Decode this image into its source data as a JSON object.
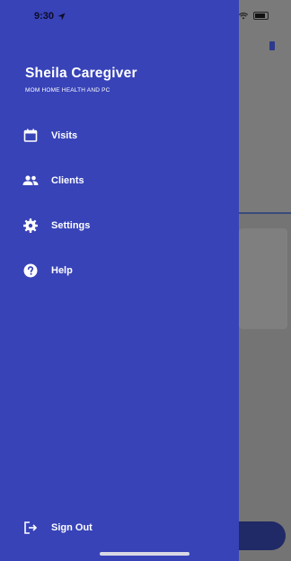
{
  "status_bar": {
    "time": "9:30"
  },
  "drawer": {
    "user_name": "Sheila Caregiver",
    "organization": "MOM HOME HEALTH AND PC",
    "menu": [
      {
        "label": "Visits",
        "icon": "calendar-icon"
      },
      {
        "label": "Clients",
        "icon": "people-icon"
      },
      {
        "label": "Settings",
        "icon": "gear-icon"
      },
      {
        "label": "Help",
        "icon": "help-icon"
      }
    ],
    "sign_out_label": "Sign Out",
    "sign_out_icon": "sign-out-icon"
  },
  "colors": {
    "drawer_background": "#3843b8",
    "overlay": "#747474",
    "text": "#ffffff"
  }
}
